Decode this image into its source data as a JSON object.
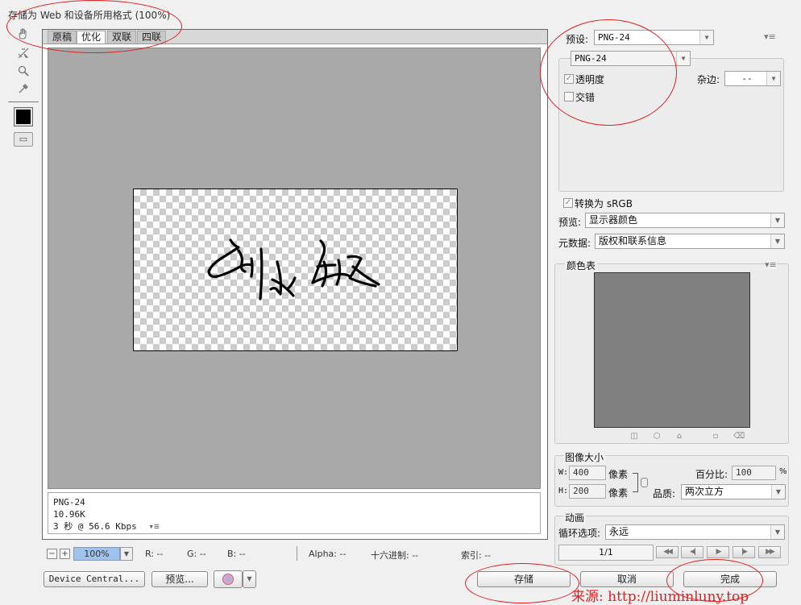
{
  "window": {
    "title": "存储为 Web 和设备所用格式 (100%)"
  },
  "toolbar": {
    "tools": [
      "hand-icon",
      "slice-select-icon",
      "zoom-icon",
      "eyedropper-icon"
    ],
    "eyedropper_color": "#000000"
  },
  "tabs": [
    {
      "label": "原稿",
      "active": false
    },
    {
      "label": "优化",
      "active": true
    },
    {
      "label": "双联",
      "active": false
    },
    {
      "label": "四联",
      "active": false
    }
  ],
  "preview": {
    "info_format": "PNG-24",
    "info_size": "10.96K",
    "info_time": "3 秒 @ 56.6 Kbps",
    "info_menu": "▾≡"
  },
  "status": {
    "zoom_value": "100%",
    "r": "R: --",
    "g": "G: --",
    "b": "B: --",
    "alpha": "Alpha: --",
    "hex": "十六进制: --",
    "index": "索引: --"
  },
  "buttons": {
    "device_central": "Device Central...",
    "preview": "预览...",
    "save": "存储",
    "cancel": "取消",
    "done": "完成"
  },
  "settings": {
    "preset_label": "预设:",
    "preset_value": "PNG-24",
    "format_value": "PNG-24",
    "transparency_label": "透明度",
    "transparency_checked": true,
    "interlaced_label": "交错",
    "interlaced_checked": false,
    "matte_label": "杂边:",
    "matte_value": "--",
    "convert_srgb_label": "转换为 sRGB",
    "convert_srgb_checked": true,
    "preview_label": "预览:",
    "preview_value": "显示器颜色",
    "metadata_label": "元数据:",
    "metadata_value": "版权和联系信息"
  },
  "color_table": {
    "title": "颜色表",
    "fill": "#808080",
    "icons": [
      "web-snap-icon",
      "cube-icon",
      "lock-icon",
      "new-color-icon",
      "trash-icon"
    ]
  },
  "image_size": {
    "title": "图像大小",
    "w_label": "W:",
    "w_value": "400",
    "h_label": "H:",
    "h_value": "200",
    "unit": "像素",
    "percent_label": "百分比:",
    "percent_value": "100",
    "percent_sign": "%",
    "quality_label": "品质:",
    "quality_value": "两次立方"
  },
  "animation": {
    "title": "动画",
    "loop_label": "循环选项:",
    "loop_value": "永远",
    "frame_counter": "1/1"
  },
  "watermark": "来源: http://liuminluny.top",
  "annotation_color": "#e02020"
}
